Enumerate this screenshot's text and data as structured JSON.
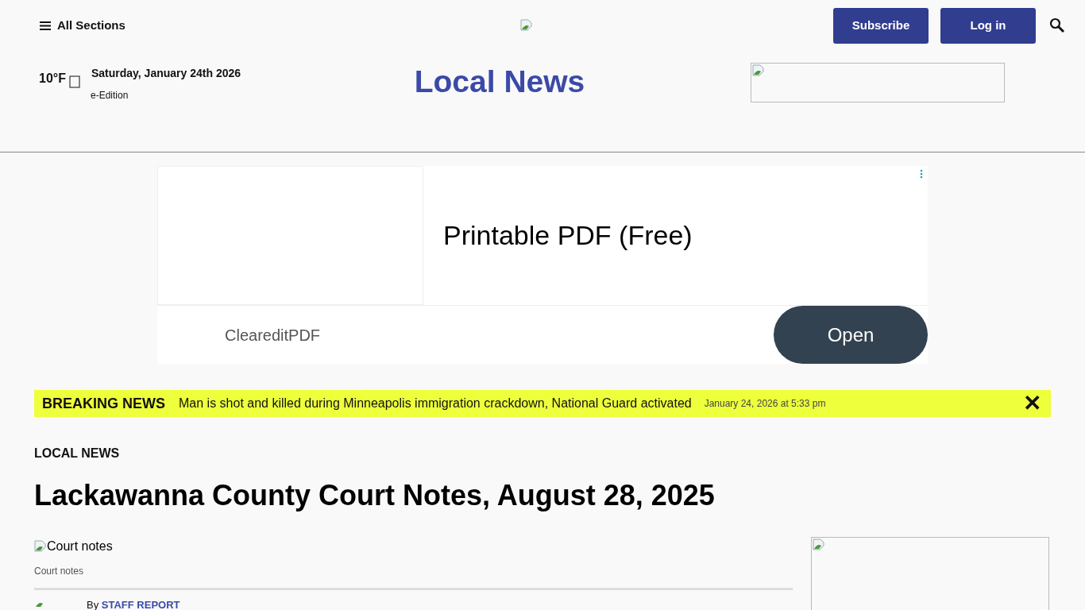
{
  "header": {
    "menu_label": "All Sections",
    "buttons": [
      "Subscribe",
      "Log in"
    ]
  },
  "weather": {
    "temperature": "10°F"
  },
  "date": "Saturday, January 24th 2026",
  "edition_link": "e-Edition",
  "section_title": "Local News",
  "ad": {
    "headline": "Printable PDF (Free)",
    "advertiser": "CleareditPDF",
    "button": "Open"
  },
  "breaking": {
    "label": "BREAKING NEWS",
    "headline": "Man is shot and killed during Minneapolis immigration crackdown, National Guard activated",
    "time": "January 24, 2026 at 5:33 pm",
    "close": "✕"
  },
  "article": {
    "category": "LOCAL NEWS",
    "title": "Lackawanna County Court Notes, August 28, 2025",
    "image_alt": "Court notes",
    "caption": "Court notes",
    "byline_prefix": "By",
    "author": "STAFF REPORT"
  }
}
